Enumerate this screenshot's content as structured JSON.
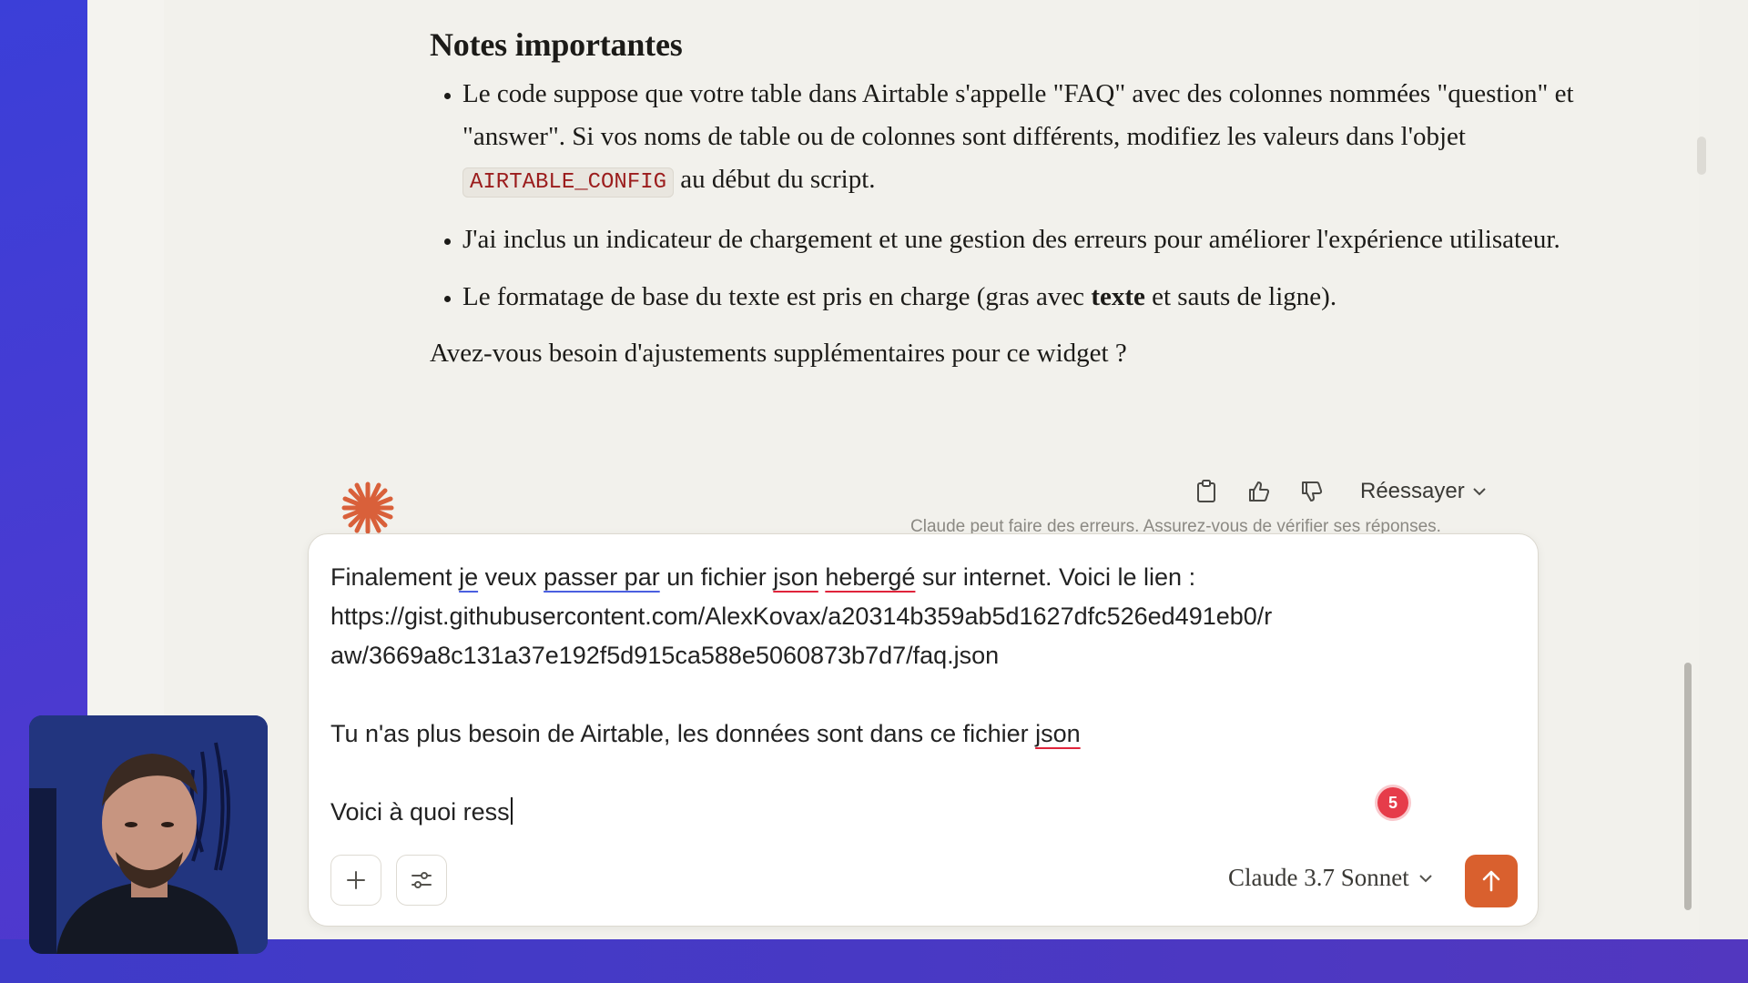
{
  "assistant": {
    "heading": "Notes importantes",
    "bullets": [
      {
        "before": "Le code suppose que votre table dans Airtable s'appelle \"FAQ\" avec des colonnes nommées \"question\" et \"answer\". Si vos noms de table ou de colonnes sont différents, modifiez les valeurs dans l'objet ",
        "code": "AIRTABLE_CONFIG",
        "after": " au début du script."
      },
      {
        "text": "J'ai inclus un indicateur de chargement et une gestion des erreurs pour améliorer l'expérience utilisateur."
      },
      {
        "before": "Le formatage de base du texte est pris en charge (gras avec ",
        "bold": "texte",
        "after": " et sauts de ligne)."
      }
    ],
    "closing": "Avez-vous besoin d'ajustements supplémentaires pour ce widget ?"
  },
  "actions": {
    "copy_icon": "clipboard-icon",
    "like_icon": "thumbs-up-icon",
    "dislike_icon": "thumbs-down-icon",
    "retry_label": "Réessayer",
    "disclaimer": "Claude peut faire des erreurs. Assurez-vous de vérifier ses réponses."
  },
  "composer": {
    "line1": {
      "p1": "Finalement ",
      "w1": "je",
      "p2": " veux ",
      "w2": "passer par",
      "p3": " un fichier ",
      "w3": "json",
      "p4": " ",
      "w4": "hebergé",
      "p5": " sur internet. Voici le lien :"
    },
    "line2": "https://gist.githubusercontent.com/AlexKovax/a20314b359ab5d1627dfc526ed491eb0/r",
    "line3": "aw/3669a8c131a37e192f5d915ca588e5060873b7d7/faq.json",
    "line5": {
      "p1": "Tu n'as plus besoin de Airtable, les données sont dans ce fichier ",
      "w1": "json"
    },
    "line7": "Voici à quoi ress",
    "issue_count": "5",
    "add_icon": "plus-icon",
    "options_icon": "sliders-icon",
    "model_label": "Claude 3.7 Sonnet",
    "send_icon": "arrow-up-icon"
  },
  "colors": {
    "accent": "#d9602e",
    "logo": "#d9603a",
    "background": "#f2f1ec",
    "spell_red": "#e0243b",
    "grammar_blue": "#4a5fe0"
  }
}
